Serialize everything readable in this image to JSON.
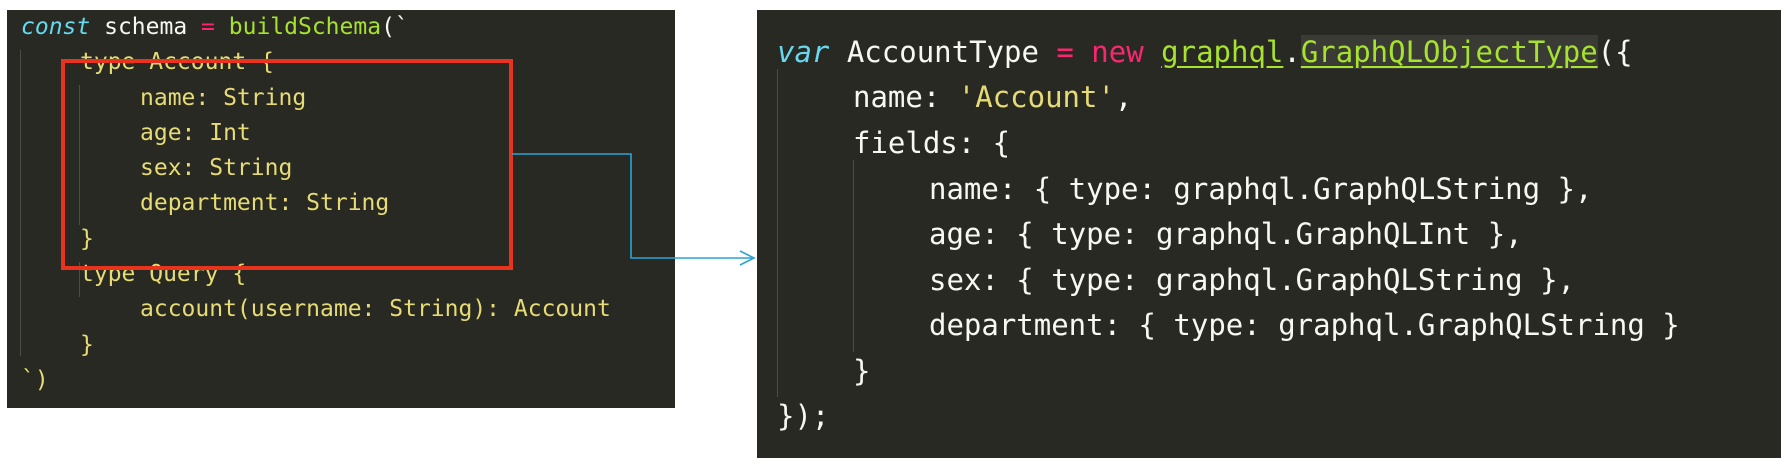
{
  "left_code": {
    "l1": {
      "a": "const",
      "b": " schema ",
      "c": "=",
      "d": " ",
      "e": "buildSchema",
      "f": "(`"
    },
    "l2": "type Account {",
    "l3": "name: String",
    "l4": "age: Int",
    "l5": "sex: String",
    "l6": "department: String",
    "l7": "}",
    "l8": "type Query {",
    "l9": "account(username: String): Account",
    "l10": "}",
    "l11": "`)"
  },
  "right_code": {
    "l1": {
      "a": "var",
      "b": " AccountType ",
      "c": "=",
      "d": " new ",
      "e": "graphql",
      "f": ".",
      "g": "GraphQLObjectType",
      "h": "({"
    },
    "l2": {
      "a": "name: ",
      "b": "'Account'",
      "c": ","
    },
    "l3": "fields: {",
    "l4": "name: { type: graphql.GraphQLString },",
    "l5": "age: { type: graphql.GraphQLInt },",
    "l6": "sex: { type: graphql.GraphQLString },",
    "l7": "department: { type: graphql.GraphQLString }",
    "l8": "}",
    "l9": "});"
  },
  "colors": {
    "background": "#282923",
    "highlight_box": "#e8341c",
    "connector_arrow": "#2aa4d8"
  }
}
